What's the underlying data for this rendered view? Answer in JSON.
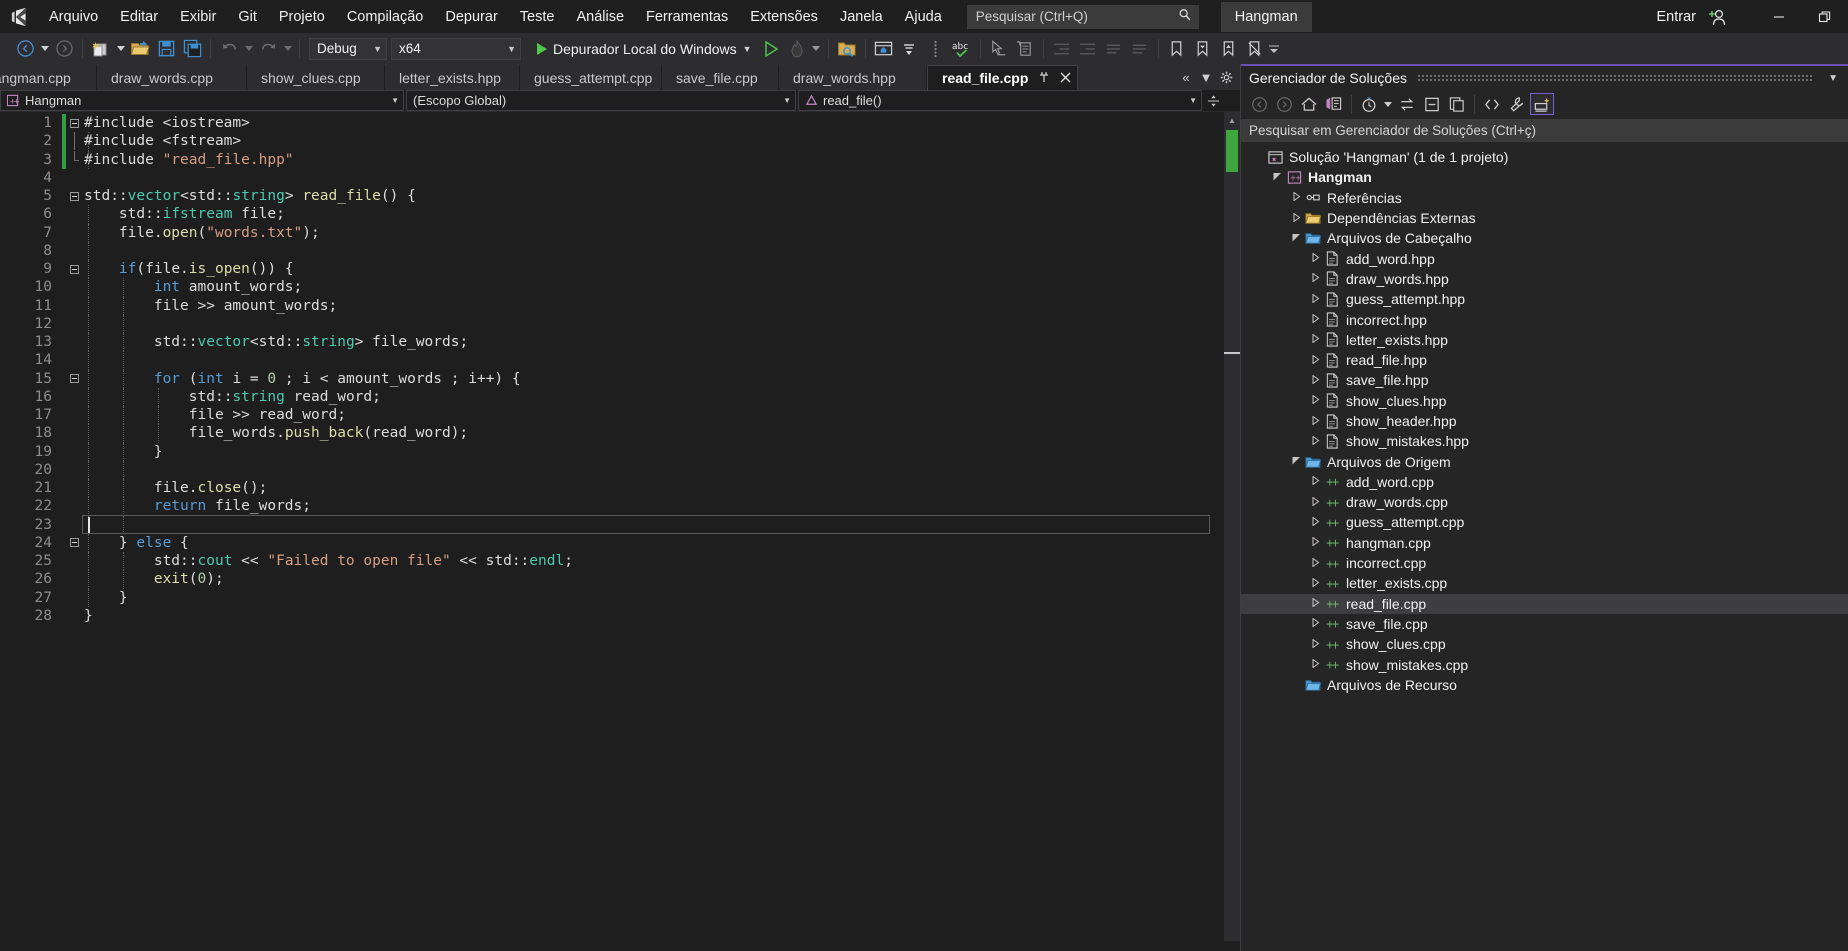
{
  "menu": {
    "items": [
      "Arquivo",
      "Editar",
      "Exibir",
      "Git",
      "Projeto",
      "Compilação",
      "Depurar",
      "Teste",
      "Análise",
      "Ferramentas",
      "Extensões",
      "Janela",
      "Ajuda"
    ],
    "search_placeholder": "Pesquisar (Ctrl+Q)",
    "solution_pill": "Hangman",
    "sign_in": "Entrar"
  },
  "toolbar": {
    "configuration": "Debug",
    "platform": "x64",
    "run_label": "Depurador Local do Windows"
  },
  "tabs": [
    {
      "label": "hangman.cpp",
      "active": false
    },
    {
      "label": "draw_words.cpp",
      "active": false
    },
    {
      "label": "show_clues.cpp",
      "active": false
    },
    {
      "label": "letter_exists.hpp",
      "active": false
    },
    {
      "label": "guess_attempt.cpp",
      "active": false
    },
    {
      "label": "save_file.cpp",
      "active": false
    },
    {
      "label": "draw_words.hpp",
      "active": false
    },
    {
      "label": "read_file.cpp",
      "active": true
    }
  ],
  "navbar": {
    "project": "Hangman",
    "scope": "(Escopo Global)",
    "member": "read_file()"
  },
  "editor": {
    "current_line": 23,
    "lines": [
      {
        "n": 1,
        "text": "#include <iostream>"
      },
      {
        "n": 2,
        "text": "#include <fstream>"
      },
      {
        "n": 3,
        "text": "#include \"read_file.hpp\""
      },
      {
        "n": 4,
        "text": ""
      },
      {
        "n": 5,
        "text": "std::vector<std::string> read_file() {"
      },
      {
        "n": 6,
        "text": "    std::ifstream file;"
      },
      {
        "n": 7,
        "text": "    file.open(\"words.txt\");"
      },
      {
        "n": 8,
        "text": ""
      },
      {
        "n": 9,
        "text": "    if(file.is_open()) {"
      },
      {
        "n": 10,
        "text": "        int amount_words;"
      },
      {
        "n": 11,
        "text": "        file >> amount_words;"
      },
      {
        "n": 12,
        "text": ""
      },
      {
        "n": 13,
        "text": "        std::vector<std::string> file_words;"
      },
      {
        "n": 14,
        "text": ""
      },
      {
        "n": 15,
        "text": "        for (int i = 0 ; i < amount_words ; i++) {"
      },
      {
        "n": 16,
        "text": "            std::string read_word;"
      },
      {
        "n": 17,
        "text": "            file >> read_word;"
      },
      {
        "n": 18,
        "text": "            file_words.push_back(read_word);"
      },
      {
        "n": 19,
        "text": "        }"
      },
      {
        "n": 20,
        "text": ""
      },
      {
        "n": 21,
        "text": "        file.close();"
      },
      {
        "n": 22,
        "text": "        return file_words;"
      },
      {
        "n": 23,
        "text": ""
      },
      {
        "n": 24,
        "text": "    } else {"
      },
      {
        "n": 25,
        "text": "        std::cout << \"Failed to open file\" << std::endl;"
      },
      {
        "n": 26,
        "text": "        exit(0);"
      },
      {
        "n": 27,
        "text": "    }"
      },
      {
        "n": 28,
        "text": "}"
      }
    ]
  },
  "solution_explorer": {
    "title": "Gerenciador de Soluções",
    "search_placeholder": "Pesquisar em Gerenciador de Soluções (Ctrl+ç)",
    "tree": [
      {
        "level": 0,
        "label": "Solução 'Hangman' (1 de 1 projeto)",
        "icon": "solution-icon",
        "arrow": "",
        "bold": false,
        "selected": false
      },
      {
        "level": 1,
        "label": "Hangman",
        "icon": "cpp-project-icon",
        "arrow": "down",
        "bold": true,
        "selected": false
      },
      {
        "level": 2,
        "label": "Referências",
        "icon": "references-icon",
        "arrow": "right",
        "bold": false,
        "selected": false
      },
      {
        "level": 2,
        "label": "Dependências Externas",
        "icon": "folder-deps-icon",
        "arrow": "right",
        "bold": false,
        "selected": false
      },
      {
        "level": 2,
        "label": "Arquivos de Cabeçalho",
        "icon": "folder-icon",
        "arrow": "down",
        "bold": false,
        "selected": false
      },
      {
        "level": 3,
        "label": "add_word.hpp",
        "icon": "header-file-icon",
        "arrow": "right",
        "bold": false,
        "selected": false
      },
      {
        "level": 3,
        "label": "draw_words.hpp",
        "icon": "header-file-icon",
        "arrow": "right",
        "bold": false,
        "selected": false
      },
      {
        "level": 3,
        "label": "guess_attempt.hpp",
        "icon": "header-file-icon",
        "arrow": "right",
        "bold": false,
        "selected": false
      },
      {
        "level": 3,
        "label": "incorrect.hpp",
        "icon": "header-file-icon",
        "arrow": "right",
        "bold": false,
        "selected": false
      },
      {
        "level": 3,
        "label": "letter_exists.hpp",
        "icon": "header-file-icon",
        "arrow": "right",
        "bold": false,
        "selected": false
      },
      {
        "level": 3,
        "label": "read_file.hpp",
        "icon": "header-file-icon",
        "arrow": "right",
        "bold": false,
        "selected": false
      },
      {
        "level": 3,
        "label": "save_file.hpp",
        "icon": "header-file-icon",
        "arrow": "right",
        "bold": false,
        "selected": false
      },
      {
        "level": 3,
        "label": "show_clues.hpp",
        "icon": "header-file-icon",
        "arrow": "right",
        "bold": false,
        "selected": false
      },
      {
        "level": 3,
        "label": "show_header.hpp",
        "icon": "header-file-icon",
        "arrow": "right",
        "bold": false,
        "selected": false
      },
      {
        "level": 3,
        "label": "show_mistakes.hpp",
        "icon": "header-file-icon",
        "arrow": "right",
        "bold": false,
        "selected": false
      },
      {
        "level": 2,
        "label": "Arquivos de Origem",
        "icon": "folder-icon",
        "arrow": "down",
        "bold": false,
        "selected": false
      },
      {
        "level": 3,
        "label": "add_word.cpp",
        "icon": "cpp-file-icon",
        "arrow": "right",
        "bold": false,
        "selected": false
      },
      {
        "level": 3,
        "label": "draw_words.cpp",
        "icon": "cpp-file-icon",
        "arrow": "right",
        "bold": false,
        "selected": false
      },
      {
        "level": 3,
        "label": "guess_attempt.cpp",
        "icon": "cpp-file-icon",
        "arrow": "right",
        "bold": false,
        "selected": false
      },
      {
        "level": 3,
        "label": "hangman.cpp",
        "icon": "cpp-file-icon",
        "arrow": "right",
        "bold": false,
        "selected": false
      },
      {
        "level": 3,
        "label": "incorrect.cpp",
        "icon": "cpp-file-icon",
        "arrow": "right",
        "bold": false,
        "selected": false
      },
      {
        "level": 3,
        "label": "letter_exists.cpp",
        "icon": "cpp-file-icon",
        "arrow": "right",
        "bold": false,
        "selected": false
      },
      {
        "level": 3,
        "label": "read_file.cpp",
        "icon": "cpp-file-icon",
        "arrow": "right",
        "bold": false,
        "selected": true
      },
      {
        "level": 3,
        "label": "save_file.cpp",
        "icon": "cpp-file-icon",
        "arrow": "right",
        "bold": false,
        "selected": false
      },
      {
        "level": 3,
        "label": "show_clues.cpp",
        "icon": "cpp-file-icon",
        "arrow": "right",
        "bold": false,
        "selected": false
      },
      {
        "level": 3,
        "label": "show_mistakes.cpp",
        "icon": "cpp-file-icon",
        "arrow": "right",
        "bold": false,
        "selected": false
      },
      {
        "level": 2,
        "label": "Arquivos de Recurso",
        "icon": "folder-icon",
        "arrow": "",
        "bold": false,
        "selected": false
      }
    ]
  },
  "colors": {
    "accent_purple": "#6a4fb5",
    "run_green": "#4ec94e",
    "changebar_green": "#2ea043",
    "bg_editor": "#1e1e1e",
    "bg_chrome": "#2d2d30",
    "bg_panel": "#252526"
  }
}
